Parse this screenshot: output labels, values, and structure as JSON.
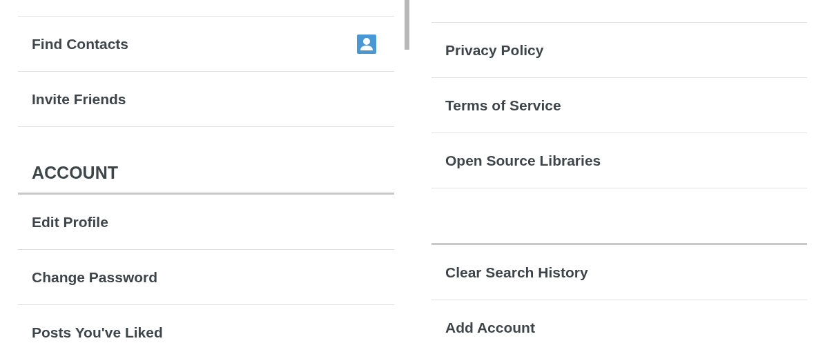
{
  "left_list": [
    {
      "kind": "icon-row",
      "label": "Find Contacts"
    },
    {
      "kind": "row",
      "label": "Invite Friends"
    },
    {
      "kind": "header",
      "label": "ACCOUNT"
    },
    {
      "kind": "row",
      "label": "Edit Profile"
    },
    {
      "kind": "row",
      "label": "Change Password"
    },
    {
      "kind": "row",
      "label": "Posts You've Liked"
    }
  ],
  "right_list": [
    {
      "kind": "row",
      "label": "Privacy Policy"
    },
    {
      "kind": "row",
      "label": "Terms of Service"
    },
    {
      "kind": "row",
      "label": "Open Source Libraries"
    },
    {
      "kind": "gap"
    },
    {
      "kind": "row",
      "label": "Clear Search History"
    },
    {
      "kind": "row",
      "label": "Add Account"
    }
  ]
}
